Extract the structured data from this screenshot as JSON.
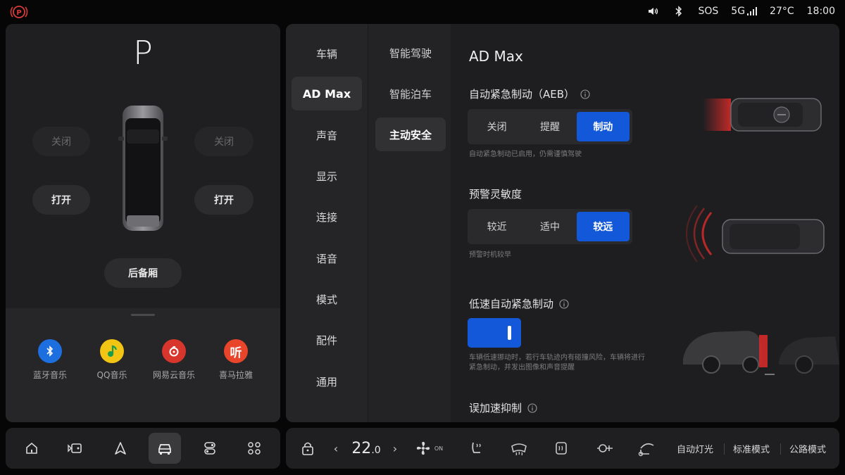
{
  "status": {
    "park_brake_icon": "parking-brake-icon",
    "sos": "SOS",
    "network": "5G",
    "temperature": "27°C",
    "time": "18:00"
  },
  "vehicle": {
    "gear": "P",
    "door_front_left": "关闭",
    "door_front_right": "关闭",
    "door_rear_left": "打开",
    "door_rear_right": "打开",
    "trunk": "后备厢"
  },
  "media_apps": [
    {
      "label": "蓝牙音乐",
      "icon": "bluetooth-icon",
      "color": "#1d6fe0"
    },
    {
      "label": "QQ音乐",
      "icon": "qq-music-icon",
      "color": "#f2c414"
    },
    {
      "label": "网易云音乐",
      "icon": "netease-music-icon",
      "color": "#d8352c"
    },
    {
      "label": "喜马拉雅",
      "icon": "ximalaya-icon",
      "color": "#e8452a"
    }
  ],
  "settings_nav": [
    "车辆",
    "AD Max",
    "声音",
    "显示",
    "连接",
    "语音",
    "模式",
    "配件",
    "通用"
  ],
  "settings_nav_active": "AD Max",
  "sub_nav": [
    "智能驾驶",
    "智能泊车",
    "主动安全"
  ],
  "sub_nav_active": "主动安全",
  "content": {
    "title": "AD Max",
    "aeb": {
      "title": "自动紧急制动（AEB）",
      "options": [
        "关闭",
        "提醒",
        "制动"
      ],
      "selected": "制动",
      "hint": "自动紧急制动已启用，仍需谨慎驾驶"
    },
    "sensitivity": {
      "title": "预警灵敏度",
      "options": [
        "较近",
        "适中",
        "较远"
      ],
      "selected": "较远",
      "hint": "预警时机较早"
    },
    "low_speed_aeb": {
      "title": "低速自动紧急制动",
      "enabled": true,
      "hint_line1": "车辆低速挪动时，若行车轨迹内有碰撞风险，车辆将进行",
      "hint_line2": "紧急制动，并发出图像和声音提醒"
    },
    "misaccel": {
      "title": "误加速抑制"
    }
  },
  "dock": {
    "buttons": [
      "home-icon",
      "media-icon",
      "navigation-icon",
      "car-icon",
      "controls-icon",
      "apps-icon"
    ],
    "active": "car-icon"
  },
  "climate": {
    "temp_main": "22",
    "temp_decimal": ".0",
    "fan_label": "ON",
    "modes": [
      "自动灯光",
      "标准模式",
      "公路模式"
    ]
  },
  "colors": {
    "accent": "#1358d8",
    "warning_red": "#d32a2a"
  }
}
